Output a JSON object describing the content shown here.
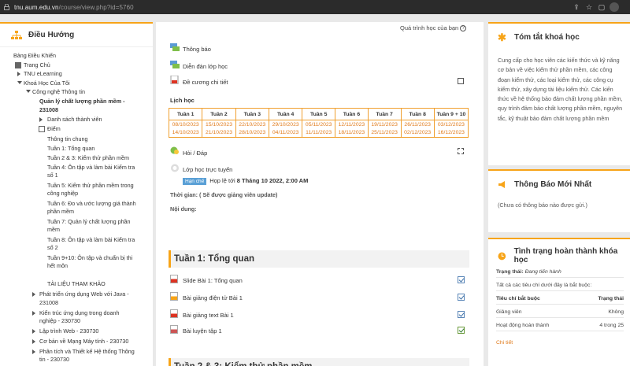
{
  "browser": {
    "url_host": "tnu.aum.edu.vn",
    "url_path": "/course/view.php?id=5760"
  },
  "left": {
    "title": "Điều Hướng",
    "items": [
      {
        "label": "Bảng Điều Khiển"
      },
      {
        "label": "Trang Chủ"
      },
      {
        "label": "TNU eLearning"
      },
      {
        "label": "Khoá Học Của Tôi"
      },
      {
        "label": "Công nghệ Thông tin"
      },
      {
        "label": "Quản lý chất lượng phần mềm -"
      },
      {
        "label": "231008"
      },
      {
        "label": "Danh sách thành viên"
      },
      {
        "label": "Điểm"
      },
      {
        "label": "Thông tin chung"
      },
      {
        "label": "Tuần 1: Tổng quan"
      },
      {
        "label": "Tuần 2 & 3: Kiểm thử phần mềm"
      },
      {
        "label": "Tuần 4: Ôn tập và làm bài Kiểm tra"
      },
      {
        "label": "số 1"
      },
      {
        "label": "Tuần 5: Kiểm thử phần mềm trong"
      },
      {
        "label": "công nghiệp"
      },
      {
        "label": "Tuần 6: Đo và ước lượng giá thành"
      },
      {
        "label": "phần mềm"
      },
      {
        "label": "Tuần 7: Quản lý chất lượng phần"
      },
      {
        "label": "mềm"
      },
      {
        "label": "Tuần 8: Ôn tập và làm bài Kiểm tra"
      },
      {
        "label": "số 2"
      },
      {
        "label": "Tuần 9+10: Ôn tập và chuẩn bị thi"
      },
      {
        "label": "hết môn"
      },
      {
        "label": "TÀI LIỆU THAM KHẢO"
      },
      {
        "label": "Phát triển ứng dụng Web với Java -"
      },
      {
        "label": "231008"
      },
      {
        "label": "Kiến trúc ứng dụng trong doanh"
      },
      {
        "label": "nghiệp - 230730"
      },
      {
        "label": "Lập trình Web - 230730"
      },
      {
        "label": "Cơ bản về Mạng Máy tính - 230730"
      },
      {
        "label": "Phân tích và Thiết kế Hệ thống Thông"
      },
      {
        "label": "tin - 230730"
      }
    ]
  },
  "center": {
    "progress_link": "Quá trình học của bạn",
    "activities": {
      "announcements": "Thông báo",
      "forum": "Diễn đàn lớp học",
      "syllabus": "Đề cương chi tiết",
      "qa": "Hỏi / Đáp",
      "online_class": "Lớp học trực tuyến"
    },
    "schedule_title": "Lịch học",
    "schedule_headers": [
      "Tuần 1",
      "Tuần 2",
      "Tuần 3",
      "Tuần 4",
      "Tuần 5",
      "Tuần 6",
      "Tuần 7",
      "Tuần 8",
      "Tuần 9 + 10"
    ],
    "schedule_start": [
      "08/10/2023",
      "15/10/2023",
      "22/10/2023",
      "29/10/2023",
      "05/11/2023",
      "12/11/2023",
      "19/11/2023",
      "26/11/2023",
      "03/12/2023"
    ],
    "schedule_end": [
      "14/10/2023",
      "21/10/2023",
      "28/10/2023",
      "04/11/2023",
      "11/11/2023",
      "18/11/2023",
      "25/11/2023",
      "02/12/2023",
      "16/12/2023"
    ],
    "meeting_badge": "Hạn chế",
    "meeting_text": "Họp lệ tới",
    "meeting_date": "8 Tháng 10 2022, 2:00 AM",
    "time_label": "Thời gian: ( Sẽ được giảng viên update)",
    "content_label": "Nội dung:",
    "section1_title": "Tuần 1: Tổng quan",
    "section1_items": [
      "Slide Bài 1: Tổng quan",
      "Bài giảng điện tử Bài 1",
      "Bài giảng text Bài 1",
      "Bài luyện tập 1"
    ],
    "section2_title": "Tuần 2 & 3: Kiểm thử phần mềm"
  },
  "right": {
    "summary_title": "Tóm tắt khoá học",
    "summary_text": "Cung cấp cho học viên các kiến thức và kỹ năng cơ bản về việc kiểm thử phần mềm, các công đoạn kiểm thử, các loại kiểm thử, các công cụ kiểm thử, xây dựng tài liệu kiểm thử. Các kiến thức về hệ thống bảo đảm chất lượng phần mềm, quy trình đảm bảo chất lượng phần mềm, nguyên tắc, kỹ thuật bảo đảm chất lượng phần mềm",
    "news_title": "Thông Báo Mới Nhất",
    "news_text": "(Chưa có thông báo nào được gửi.)",
    "completion_title": "Tình trạng hoàn thành khóa học",
    "status_label": "Trạng thái:",
    "status_value": "Đang tiến hành",
    "required_note": "Tất cả các tiêu chí dưới đây là bắt buộc:",
    "col1": "Tiêu chí bắt buộc",
    "col2": "Trạng thái",
    "rows": [
      {
        "name": "Giảng viên",
        "status": "Không"
      },
      {
        "name": "Hoạt động hoàn thành",
        "status": "4 trong 25"
      }
    ],
    "details_link": "Chi tiết"
  }
}
